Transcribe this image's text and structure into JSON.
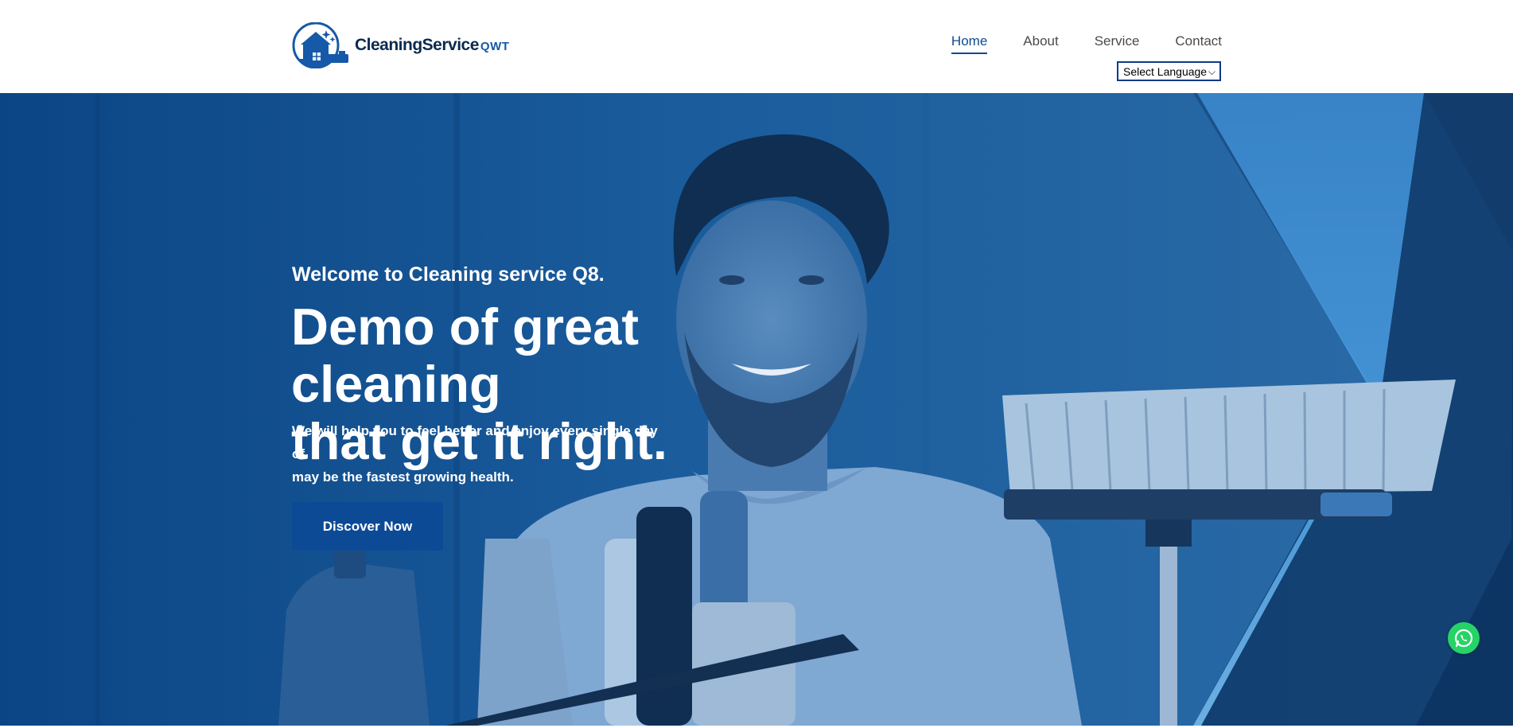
{
  "brand": {
    "name": "CleaningService",
    "suffix": "QWT",
    "logo_icon": "house-sparkle-icon"
  },
  "nav": {
    "items": [
      {
        "label": "Home",
        "active": true
      },
      {
        "label": "About",
        "active": false
      },
      {
        "label": "Service",
        "active": false
      },
      {
        "label": "Contact",
        "active": false
      }
    ]
  },
  "language_select": {
    "selected": "Select Language"
  },
  "hero": {
    "eyebrow": "Welcome to Cleaning service Q8.",
    "title_line1": "Demo of great cleaning",
    "title_line2": "that get it right.",
    "text_line1": "We will help you to feel better and enjoy every single day of",
    "text_line2": "may be the fastest growing health.",
    "cta_label": "Discover Now"
  },
  "floating": {
    "whatsapp_icon": "whatsapp-icon"
  },
  "colors": {
    "primary": "#0d4a96",
    "overlay": "#0e4c8c",
    "accent_light": "#4fa3e8",
    "whatsapp": "#25d366"
  }
}
